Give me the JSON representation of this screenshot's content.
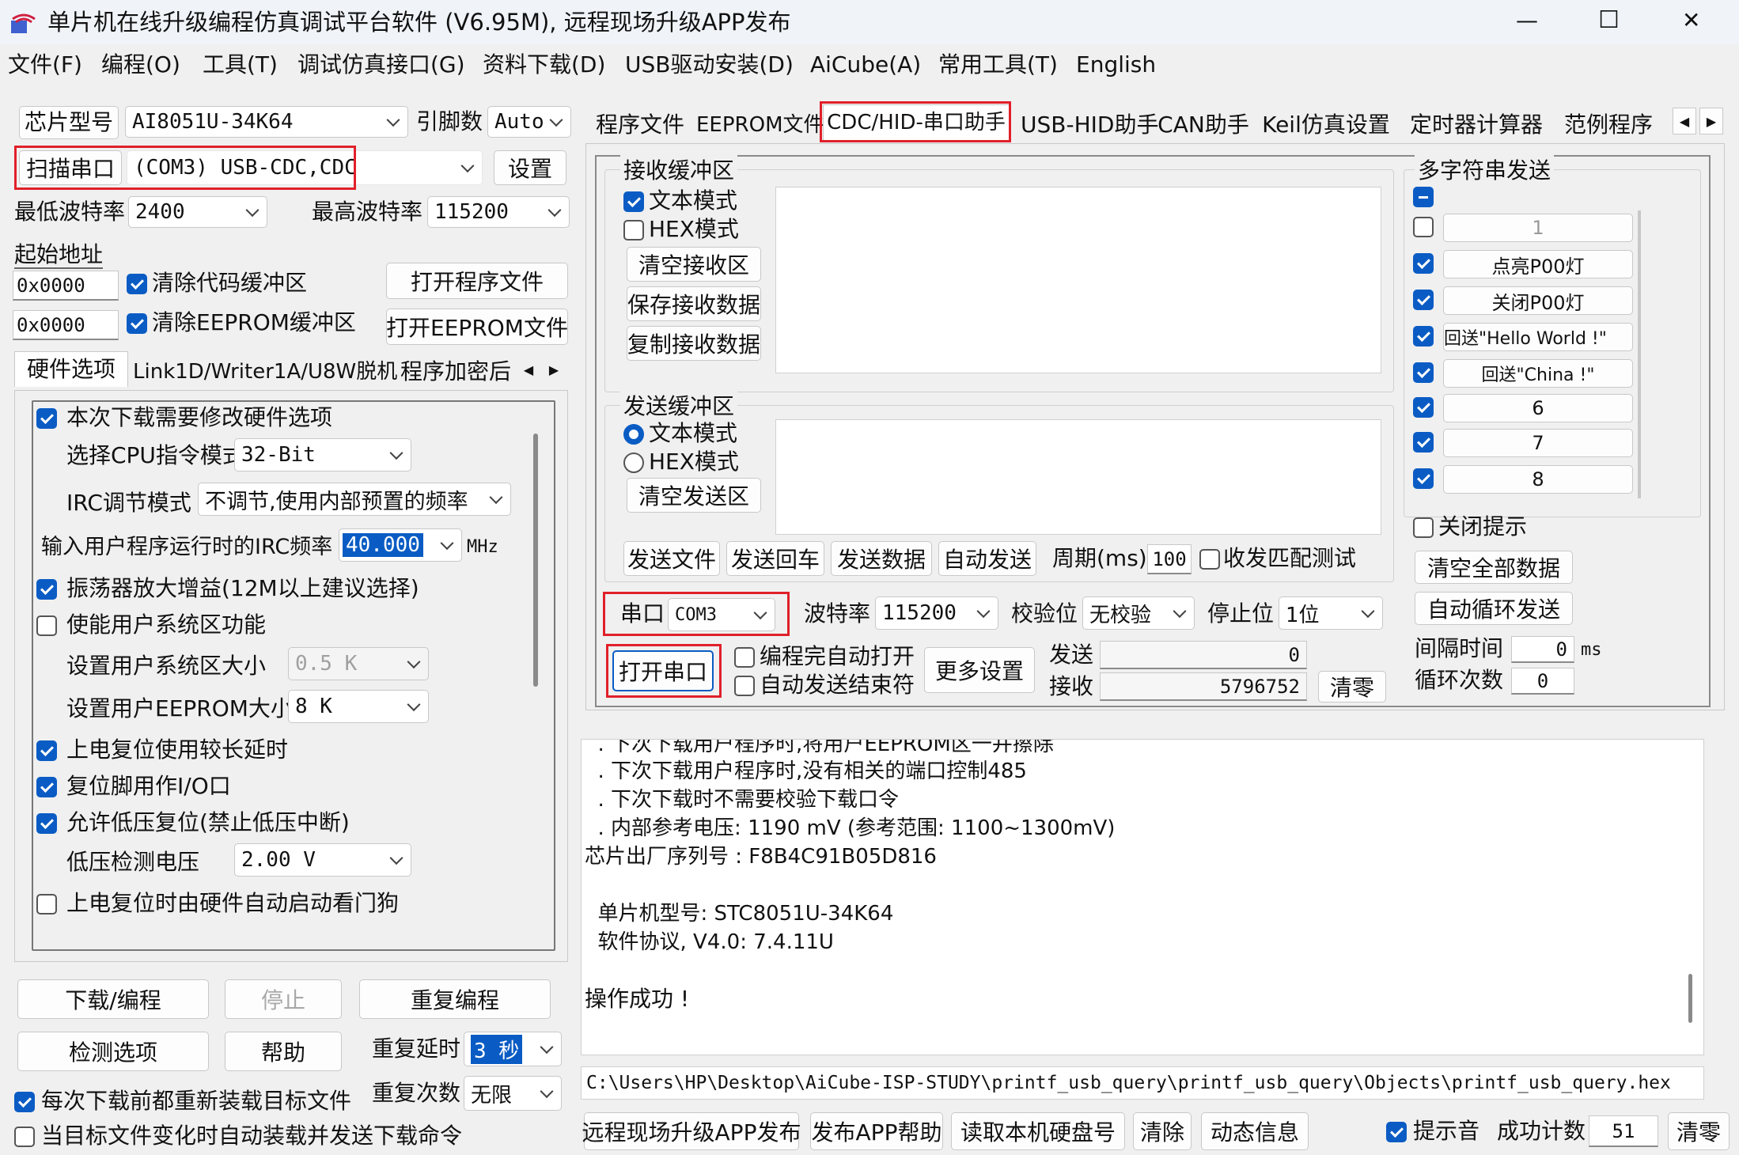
{
  "window": {
    "title": "单片机在线升级编程仿真调试平台软件 (V6.95M), 远程现场升级APP发布",
    "minimize": "—",
    "maximize": "☐",
    "close": "✕"
  },
  "menu": [
    "文件(F)",
    "编程(O)",
    "工具(T)",
    "调试仿真接口(G)",
    "资料下载(D)",
    "USB驱动安装(D)",
    "AiCube(A)",
    "常用工具(T)",
    "English"
  ],
  "left": {
    "chip_label": "芯片型号",
    "chip_value": "AI8051U-34K64",
    "pins_label": "引脚数",
    "pins_value": "Auto",
    "scan_button": "扫描串口",
    "port_value": "(COM3) USB-CDC,CDC",
    "settings_button": "设置",
    "min_baud_label": "最低波特率",
    "min_baud_value": "2400",
    "max_baud_label": "最高波特率",
    "max_baud_value": "115200",
    "start_addr_label": "起始地址",
    "addr1": "0x0000",
    "clear_code": "清除代码缓冲区",
    "open_prog": "打开程序文件",
    "addr2": "0x0000",
    "clear_eeprom": "清除EEPROM缓冲区",
    "open_eeprom": "打开EEPROM文件",
    "tabs": [
      "硬件选项",
      "Link1D/Writer1A/U8W脱机",
      "程序加密后"
    ],
    "hw": {
      "modify_hw": "本次下载需要修改硬件选项",
      "cpu_mode_label": "选择CPU指令模式",
      "cpu_mode_value": "32-Bit",
      "irc_mode_label": "IRC调节模式",
      "irc_mode_value": "不调节,使用内部预置的频率",
      "irc_freq_label": "输入用户程序运行时的IRC频率",
      "irc_freq_value": "40.000",
      "irc_unit": "MHz",
      "osc_gain": "振荡器放大增益(12M以上建议选择)",
      "user_sys": "使能用户系统区功能",
      "user_sys_size_label": "设置用户系统区大小",
      "user_sys_size_value": "0.5 K",
      "user_eeprom_label": "设置用户EEPROM大小",
      "user_eeprom_value": "8   K",
      "long_delay": "上电复位使用较长延时",
      "reset_io": "复位脚用作I/O口",
      "lvd_reset": "允许低压复位(禁止低压中断)",
      "lvd_voltage_label": "低压检测电压",
      "lvd_voltage_value": "2.00 V",
      "watchdog": "上电复位时由硬件自动启动看门狗"
    },
    "download_button": "下载/编程",
    "stop_button": "停止",
    "repeat_button": "重复编程",
    "check_button": "检测选项",
    "help_button": "帮助",
    "repeat_delay_label": "重复延时",
    "repeat_delay_value": "3 秒",
    "repeat_count_label": "重复次数",
    "repeat_count_value": "无限",
    "reload_each": "每次下载前都重新装载目标文件",
    "auto_load": "当目标文件变化时自动装载并发送下载命令"
  },
  "right_tabs": [
    "程序文件",
    "EEPROM文件",
    "CDC/HID-串口助手",
    "USB-HID助手",
    "CAN助手",
    "Keil仿真设置",
    "定时器计算器",
    "范例程序"
  ],
  "serial": {
    "recv_title": "接收缓冲区",
    "recv_text_mode": "文本模式",
    "recv_hex_mode": "HEX模式",
    "clear_recv": "清空接收区",
    "save_recv": "保存接收数据",
    "copy_recv": "复制接收数据",
    "send_title": "发送缓冲区",
    "send_text_mode": "文本模式",
    "send_hex_mode": "HEX模式",
    "clear_send": "清空发送区",
    "send_file": "发送文件",
    "send_cr": "发送回车",
    "send_data": "发送数据",
    "auto_send": "自动发送",
    "period_label": "周期(ms)",
    "period_value": "100",
    "match_test": "收发匹配测试",
    "port_label": "串口",
    "port_value": "COM3",
    "baud_label": "波特率",
    "baud_value": "115200",
    "parity_label": "校验位",
    "parity_value": "无校验",
    "stop_label": "停止位",
    "stop_value": "1位",
    "open_port": "打开串口",
    "auto_open": "编程完自动打开",
    "auto_end": "自动发送结束符",
    "more_settings": "更多设置",
    "send_count_label": "发送",
    "send_count": "0",
    "recv_count_label": "接收",
    "recv_count": "5796752",
    "clear_count": "清零"
  },
  "multi": {
    "title": "多字符串发送",
    "items": [
      "1",
      "点亮P00灯",
      "关闭P00灯",
      "回送\"Hello World !\"",
      "回送\"China !\"",
      "6",
      "7",
      "8"
    ],
    "close_tip": "关闭提示",
    "clear_all": "清空全部数据",
    "auto_loop": "自动循环发送",
    "interval_label": "间隔时间",
    "interval_value": "0",
    "interval_unit": "ms",
    "loop_label": "循环次数",
    "loop_value": "0"
  },
  "log": [
    "  . 下次下载用户程序时,将用户EEPROM区一并擦除",
    "  . 下次下载用户程序时,没有相关的端口控制485",
    "  . 下次下载时不需要校验下载口令",
    "  . 内部参考电压: 1190 mV (参考范围: 1100~1300mV)",
    "芯片出厂序列号 : F8B4C91B05D816",
    "",
    "  单片机型号: STC8051U-34K64",
    "  软件协议, V4.0: 7.4.11U",
    "",
    "操作成功 !"
  ],
  "path": "C:\\Users\\HP\\Desktop\\AiCube-ISP-STUDY\\printf_usb_query\\printf_usb_query\\Objects\\printf_usb_query.hex",
  "bottom": {
    "publish": "远程现场升级APP发布",
    "publish_help": "发布APP帮助",
    "read_disk": "读取本机硬盘号",
    "clear": "清除",
    "dynamic": "动态信息",
    "beep": "提示音",
    "success_label": "成功计数",
    "success_value": "51",
    "reset": "清零"
  },
  "colors": {
    "accent": "#0a5cc4",
    "highlight": "#e0202a"
  }
}
